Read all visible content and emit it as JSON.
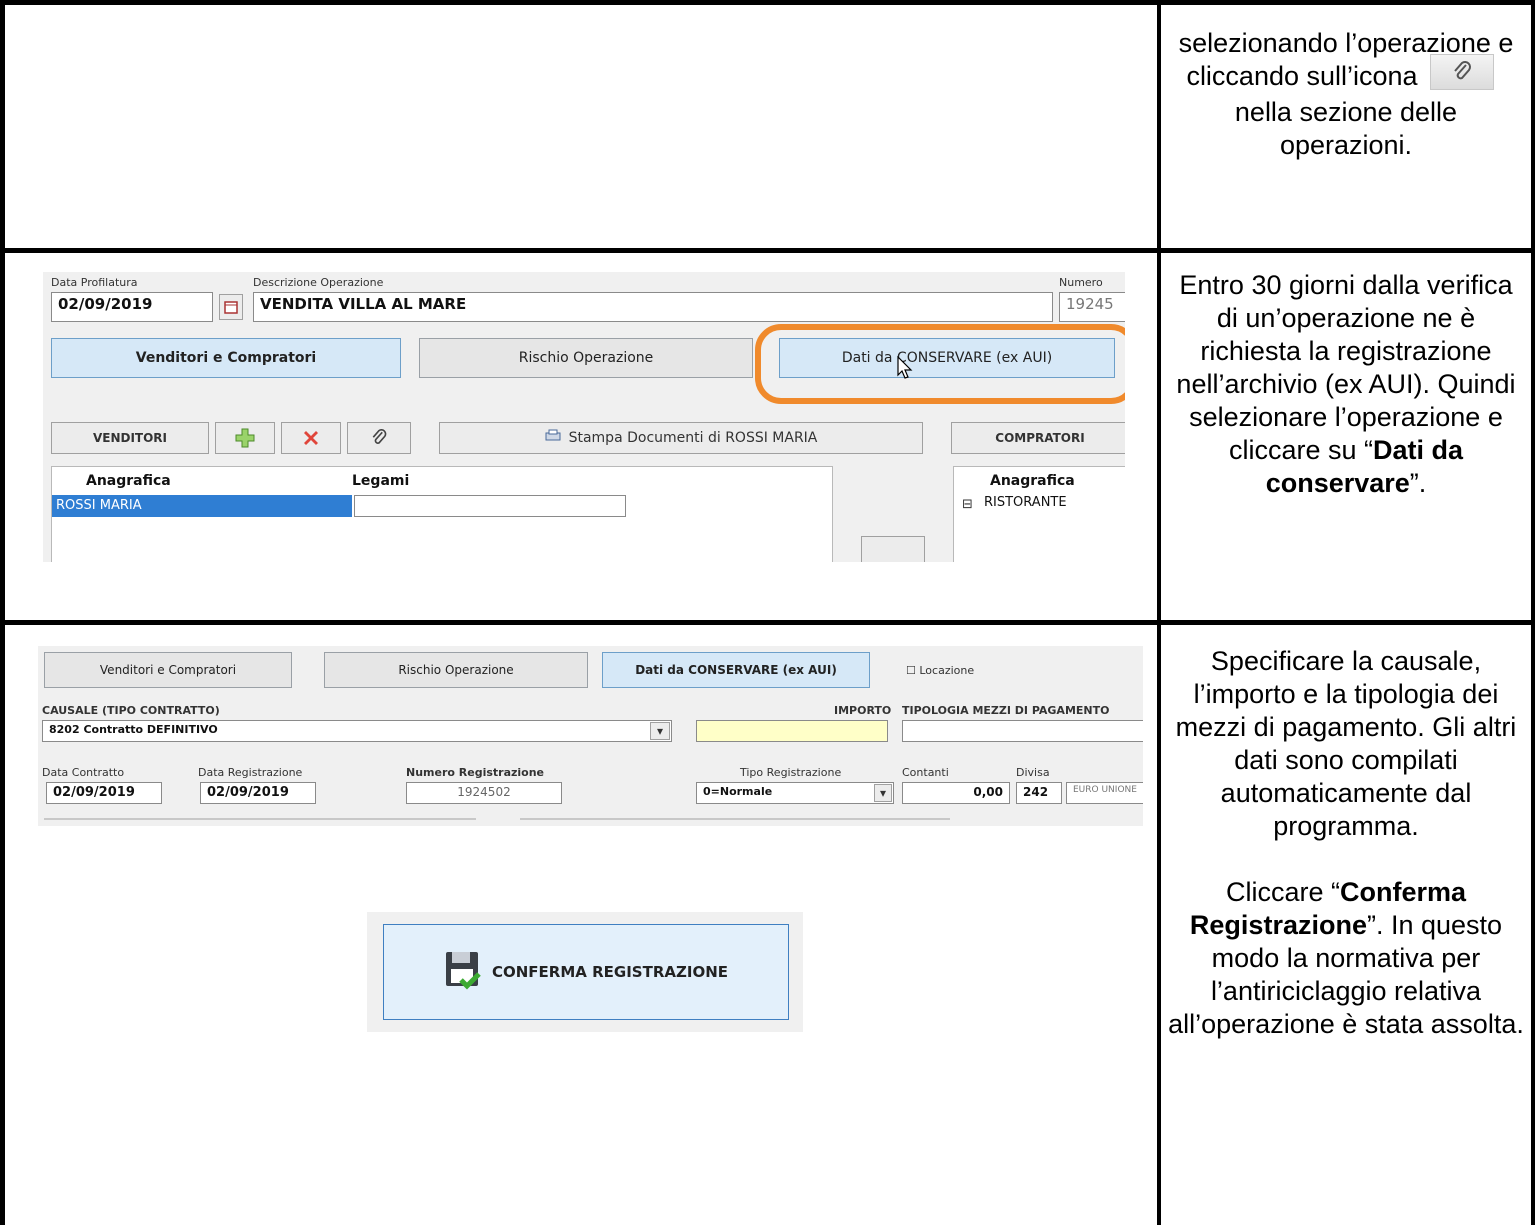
{
  "row1": {
    "text_before": "selezionando l’operazione e cliccando sull’icona",
    "text_after": "nella sezione delle operazioni.",
    "icon": "paperclip-icon"
  },
  "row2": {
    "shot": {
      "data_profilatura_label": "Data Profilatura",
      "data_profilatura_value": "02/09/2019",
      "descrizione_label": "Descrizione Operazione",
      "descrizione_value": "VENDITA VILLA AL MARE",
      "numero_label": "Numero",
      "numero_value": "19245",
      "tabs": [
        "Venditori e Compratori",
        "Rischio Operazione",
        "Dati da CONSERVARE (ex AUI)"
      ],
      "venditori_label": "VENDITORI",
      "stampa_label": "Stampa Documenti di ROSSI MARIA",
      "compratori_label": "COMPRATORI",
      "col_anagrafica": "Anagrafica",
      "col_legami": "Legami",
      "venditore_row": "ROSSI MARIA",
      "compratore_anagrafica": "Anagrafica",
      "compratore_row": "RISTORANTE",
      "highlight_color": "#f08a2c"
    },
    "text_a": "Entro 30 giorni dalla verifica di un’operazione ne è richiesta la registrazione nell’archivio (ex AUI). Quindi selezionare l’operazione e cliccare su “",
    "text_bold": "Dati da conservare",
    "text_c": "”."
  },
  "row3": {
    "shot": {
      "tabs": [
        "Venditori e Compratori",
        "Rischio Operazione",
        "Dati da CONSERVARE (ex AUI)"
      ],
      "locazione_label": "Locazione",
      "causale_label": "CAUSALE (TIPO CONTRATTO)",
      "causale_value": "8202 Contratto DEFINITIVO",
      "importo_label": "IMPORTO",
      "tipologia_label": "TIPOLOGIA MEZZI DI PAGAMENTO",
      "data_contratto_label": "Data Contratto",
      "data_contratto_value": "02/09/2019",
      "data_registrazione_label": "Data Registrazione",
      "data_registrazione_value": "02/09/2019",
      "numero_registrazione_label": "Numero Registrazione",
      "numero_registrazione_value": "1924502",
      "tipo_registrazione_label": "Tipo Registrazione",
      "tipo_registrazione_value": "0=Normale",
      "contanti_label": "Contanti",
      "contanti_value": "0,00",
      "divisa_label": "Divisa",
      "divisa_value": "242",
      "divisa_desc": "EURO UNIONE",
      "importo_color": "#ffffc8"
    },
    "conferma_label": "CONFERMA REGISTRAZIONE",
    "text_a": "Specificare la causale, l’importo e la tipologia dei mezzi di pagamento. Gli altri dati sono compilati automaticamente dal programma.",
    "text_b1": "Cliccare “",
    "text_b_bold": "Conferma Registrazione",
    "text_b2": "”. In questo modo la normativa per l’antiriciclaggio relativa all’operazione è stata assolta."
  }
}
